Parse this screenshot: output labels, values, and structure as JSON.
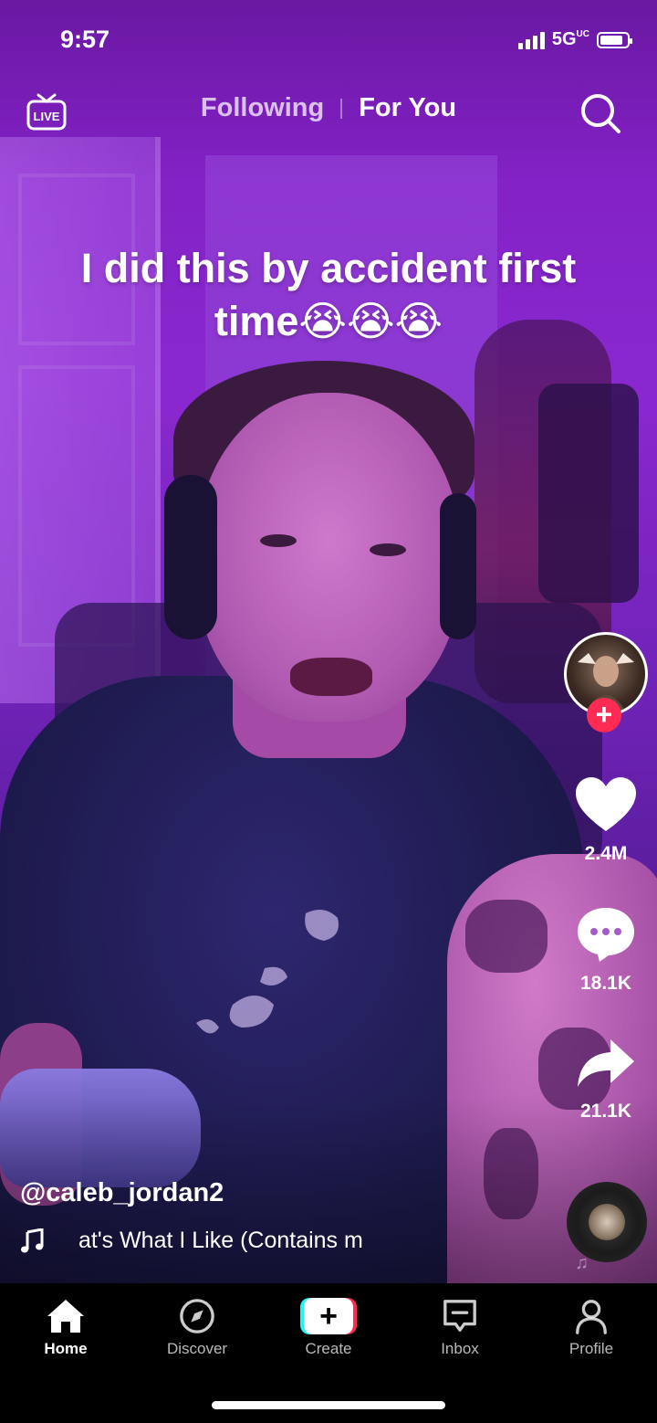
{
  "status_bar": {
    "time": "9:57",
    "network": "5G",
    "network_suffix": "UC",
    "signal_bars": 4,
    "battery_level": 0.85
  },
  "top_nav": {
    "live_label": "LIVE",
    "tabs": [
      {
        "label": "Following",
        "active": false
      },
      {
        "label": "For You",
        "active": true
      }
    ],
    "search_icon": "search-icon"
  },
  "video": {
    "caption_line1": "I  did this by accident first",
    "caption_line2": "time😭😭😭"
  },
  "right_rail": {
    "avatar_icon": "creator-avatar",
    "follow_symbol": "+",
    "like_count": "2.4M",
    "comment_count": "18.1K",
    "share_count": "21.1K"
  },
  "post_info": {
    "username": "@caleb_jordan2",
    "song": "at's What I Like (Contains m"
  },
  "bottom_nav": {
    "items": [
      {
        "label": "Home",
        "icon": "home-icon",
        "active": true
      },
      {
        "label": "Discover",
        "icon": "compass-icon",
        "active": false
      },
      {
        "label": "Create",
        "icon": "create-plus-icon",
        "active": false
      },
      {
        "label": "Inbox",
        "icon": "inbox-icon",
        "active": false
      },
      {
        "label": "Profile",
        "icon": "person-icon",
        "active": false
      }
    ],
    "create_symbol": "+"
  },
  "colors": {
    "accent_red": "#fe2c55",
    "accent_cyan": "#25f4ee"
  }
}
